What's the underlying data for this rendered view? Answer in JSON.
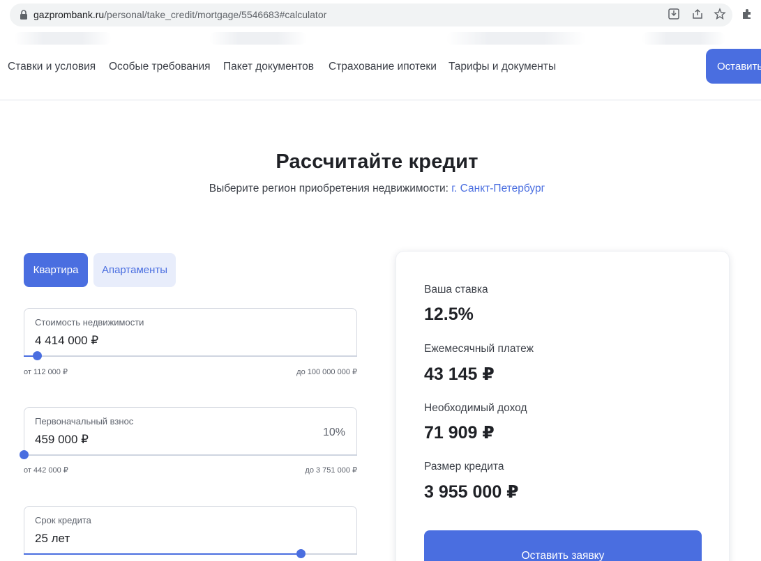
{
  "browser": {
    "url_host": "gazprombank.ru",
    "url_path": "/personal/take_credit/mortgage/5546683#calculator"
  },
  "nav": {
    "links": [
      "Ставки и условия",
      "Особые требования",
      "Пакет документов",
      "Страхование ипотеки",
      "Тарифы и документы"
    ],
    "cta_label": "Оставить з"
  },
  "calculator": {
    "title": "Рассчитайте кредит",
    "region_prompt": "Выберите регион приобретения недвижимости:",
    "region_value": "г. Санкт-Петербург",
    "tabs": [
      {
        "label": "Квартира",
        "active": true
      },
      {
        "label": "Апартаменты",
        "active": false
      }
    ],
    "fields": [
      {
        "label": "Стоимость недвижимости",
        "value": "4 414 000 ₽",
        "extra": "",
        "min": "от 112 000 ₽",
        "max": "до 100 000 000 ₽",
        "slider_fraction": 0.04
      },
      {
        "label": "Первоначальный взнос",
        "value": "459 000 ₽",
        "extra": "10%",
        "min": "от 442 000 ₽",
        "max": "до 3 751 000 ₽",
        "slider_fraction": 0.0
      },
      {
        "label": "Срок кредита",
        "value": "25 лет",
        "extra": "",
        "min": "",
        "max": "",
        "slider_fraction": 0.83
      }
    ]
  },
  "results": {
    "rate_label": "Ваша ставка",
    "rate_value": "12.5%",
    "payment_label": "Ежемесячный платеж",
    "payment_value": "43 145 ₽",
    "income_label": "Необходимый доход",
    "income_value": "71 909 ₽",
    "loan_label": "Размер кредита",
    "loan_value": "3 955 000 ₽",
    "submit_label": "Оставить заявку"
  },
  "colors": {
    "accent": "#4a6ee0",
    "accent_light": "#e8edfb",
    "text": "#1f2126"
  }
}
